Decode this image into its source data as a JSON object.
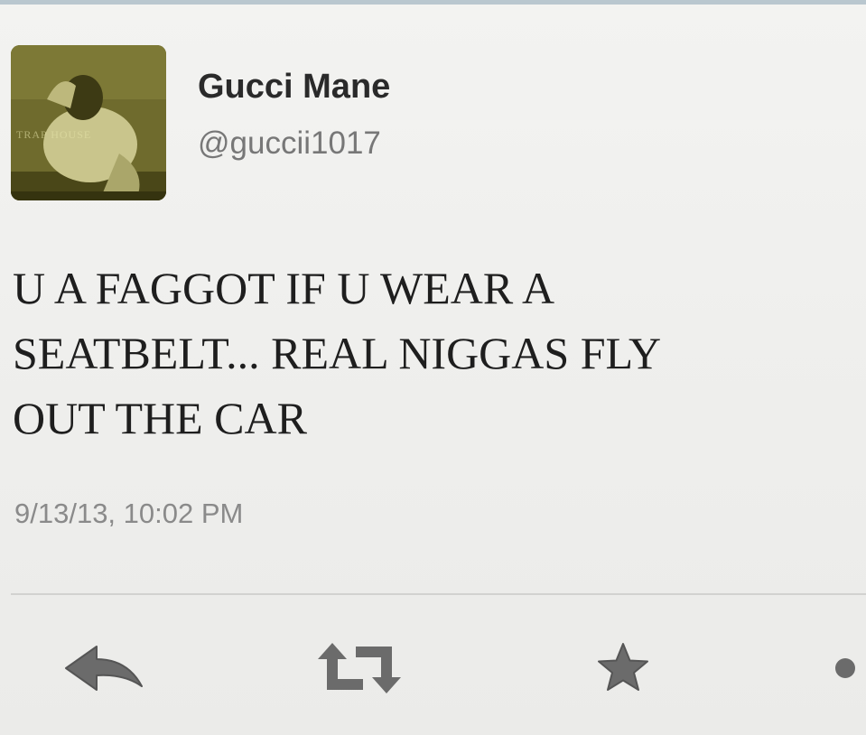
{
  "user": {
    "display_name": "Gucci Mane",
    "handle": "@guccii1017",
    "avatar_text": "TRAP HOUSE"
  },
  "tweet": {
    "text_lines": [
      "U A FAGGOT IF U WEAR A",
      "SEATBELT... REAL NIGGAS FLY",
      "OUT THE CAR"
    ],
    "timestamp": "9/13/13, 10:02 PM"
  },
  "actions": [
    {
      "name": "reply",
      "icon": "reply-icon"
    },
    {
      "name": "retweet",
      "icon": "retweet-icon"
    },
    {
      "name": "favorite",
      "icon": "star-icon"
    },
    {
      "name": "more",
      "icon": "more-icon"
    }
  ],
  "colors": {
    "text_primary": "#1e1e1e",
    "text_secondary": "#8a8a8a",
    "icon": "#6b6b6b",
    "avatar_tint": "#6e6a2c"
  }
}
